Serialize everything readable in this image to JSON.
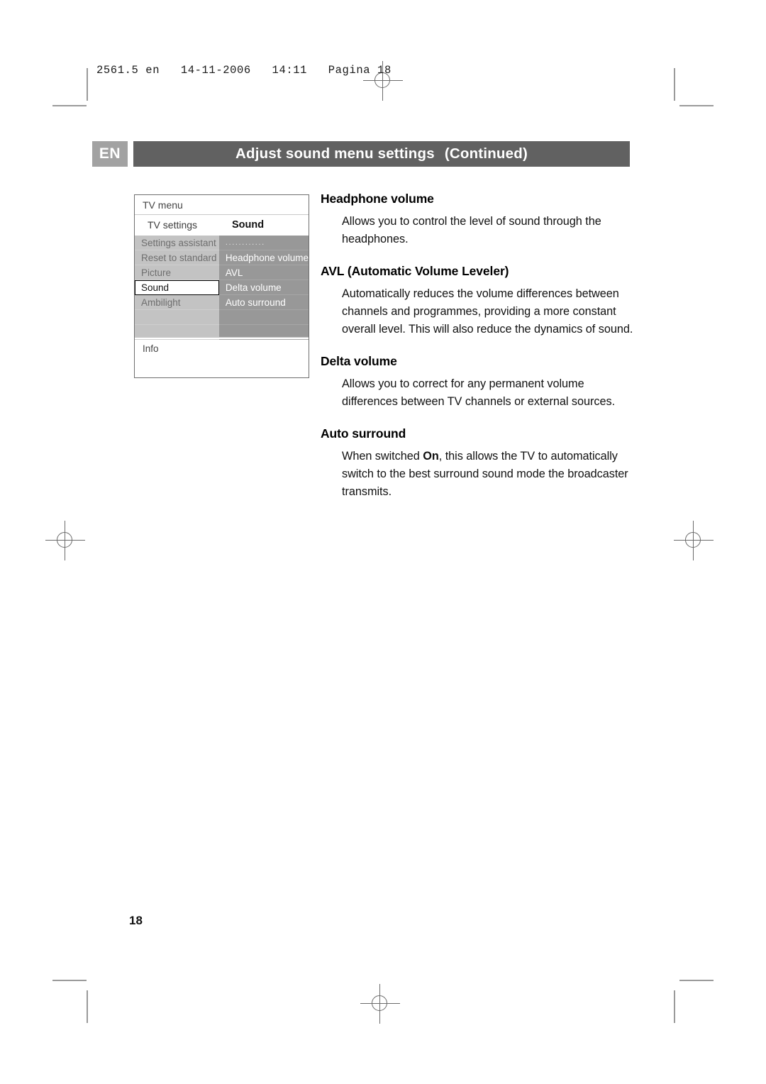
{
  "print_header": "2561.5 en   14-11-2006   14:11   Pagina 18",
  "title": {
    "language_code": "EN",
    "heading": "Adjust sound menu settings",
    "continued": "(Continued)"
  },
  "tv_menu": {
    "title": "TV menu",
    "submenu_label": "TV settings",
    "submenu_value": "Sound",
    "left_items": [
      {
        "label": "Settings assistant",
        "selected": false
      },
      {
        "label": "Reset to standard",
        "selected": false
      },
      {
        "label": "Picture",
        "selected": false
      },
      {
        "label": "Sound",
        "selected": true
      },
      {
        "label": "Ambilight",
        "selected": false
      },
      {
        "label": "",
        "selected": false
      },
      {
        "label": "",
        "selected": false
      }
    ],
    "right_items": [
      {
        "label": "............",
        "dots": true
      },
      {
        "label": "Headphone volume",
        "dots": false
      },
      {
        "label": "AVL",
        "dots": false
      },
      {
        "label": "Delta volume",
        "dots": false
      },
      {
        "label": "Auto surround",
        "dots": false
      },
      {
        "label": "",
        "dots": false
      },
      {
        "label": "",
        "dots": false
      }
    ],
    "info_label": "Info"
  },
  "sections": [
    {
      "heading": "Headphone volume",
      "body_html": "Allows you to control the level of sound through the headphones."
    },
    {
      "heading": "AVL (Automatic Volume Leveler)",
      "body_html": "Automatically reduces the volume differences between channels and programmes, providing a more constant overall level. This will also reduce the dynamics of sound."
    },
    {
      "heading": "Delta volume",
      "body_html": "Allows you to correct for any permanent volume differences between TV channels or external sources."
    },
    {
      "heading": "Auto surround",
      "body_html": "When switched <b>On</b>, this allows the TV to automatically switch to the best surround sound mode the broadcaster transmits."
    }
  ],
  "page_number": "18"
}
